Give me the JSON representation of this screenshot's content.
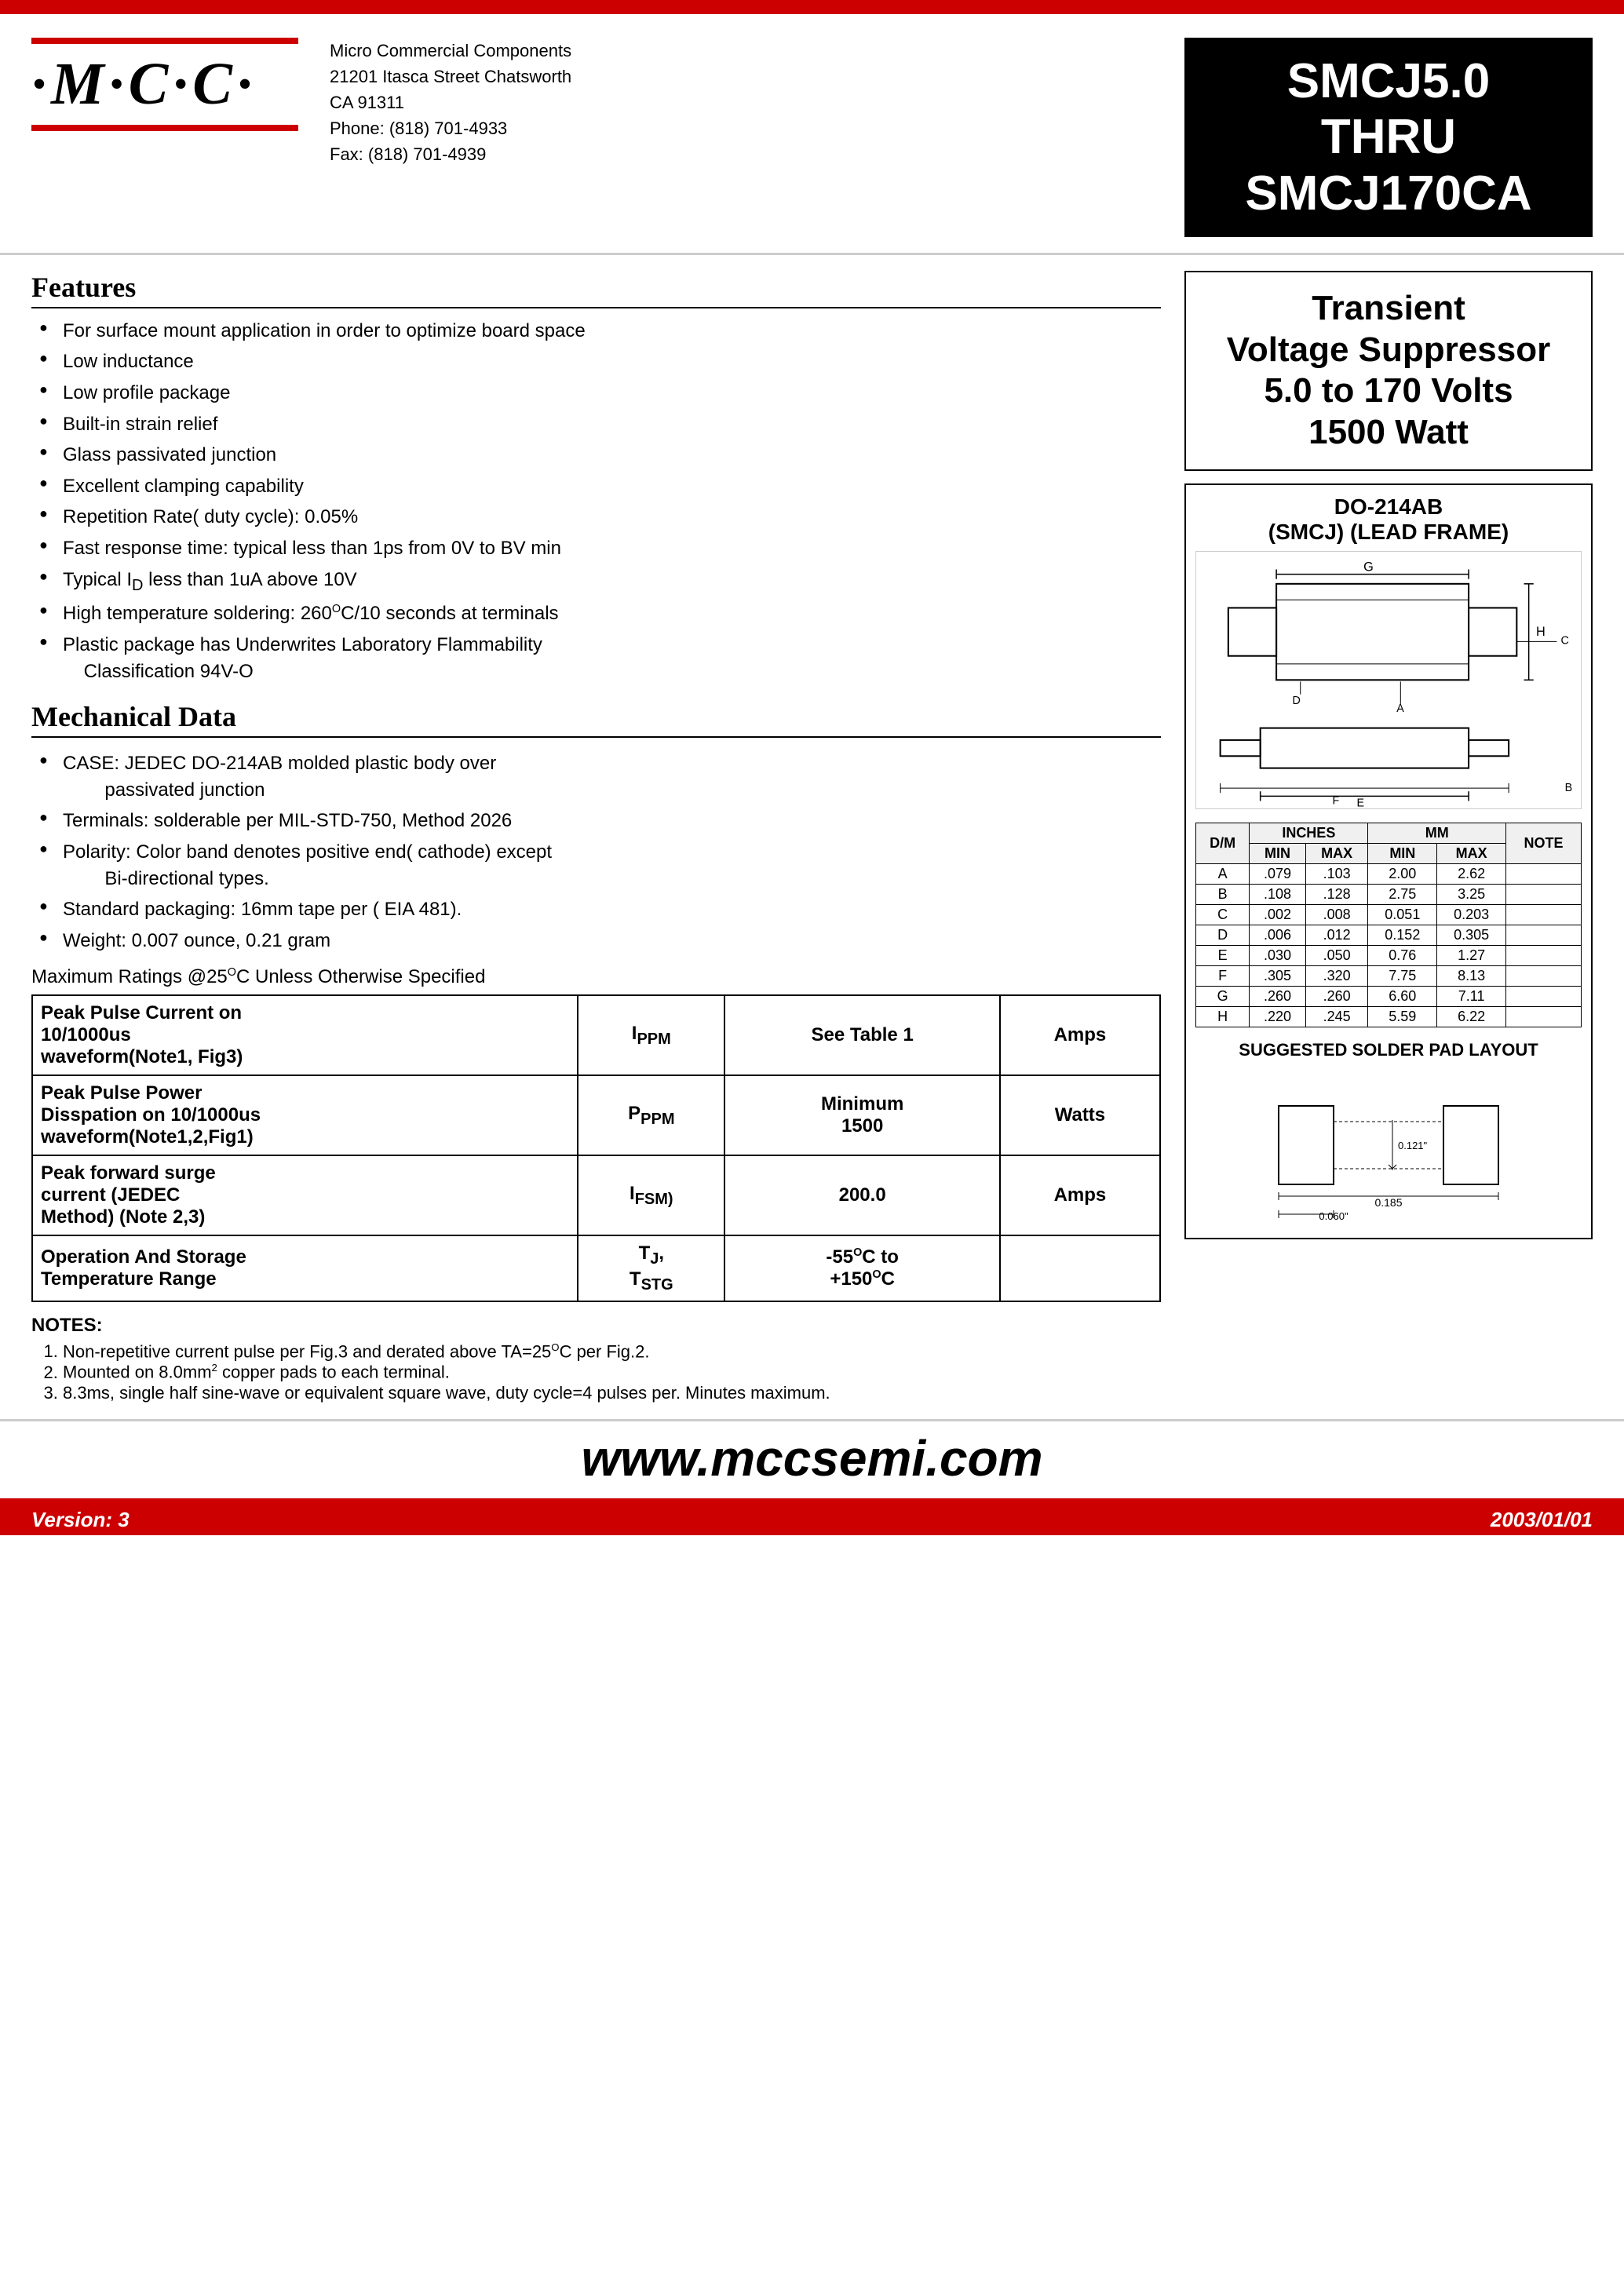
{
  "top_bar": {},
  "header": {
    "logo_text": "·M·C·C·",
    "company_name": "Micro Commercial Components",
    "company_address1": "21201 Itasca Street Chatsworth",
    "company_address2": "CA 91311",
    "company_phone": "Phone: (818) 701-4933",
    "company_fax": "Fax:    (818) 701-4939",
    "part_number": "SMCJ5.0\nTHRU\nSMCJ170CA"
  },
  "transient_box": {
    "line1": "Transient",
    "line2": "Voltage Suppressor",
    "line3": "5.0 to 170 Volts",
    "line4": "1500 Watt"
  },
  "package_box": {
    "title_line1": "DO-214AB",
    "title_line2": "(SMCJ) (LEAD FRAME)"
  },
  "features": {
    "title": "Features",
    "items": [
      "For surface mount application in order to optimize board space",
      "Low inductance",
      "Low profile package",
      "Built-in strain relief",
      "Glass passivated junction",
      "Excellent clamping capability",
      "Repetition Rate( duty cycle): 0.05%",
      "Fast response time: typical less than 1ps from 0V to BV min",
      "Typical I₀ less than 1uA above 10V",
      "High temperature soldering: 260°C/10 seconds at terminals",
      "Plastic package has Underwrites Laboratory Flammability Classification 94V-O"
    ]
  },
  "mechanical_data": {
    "title": "Mechanical Data",
    "items": [
      "CASE: JEDEC DO-214AB molded plastic body over passivated junction",
      "Terminals:  solderable per MIL-STD-750, Method 2026",
      "Polarity: Color band denotes positive end( cathode) except Bi-directional types.",
      "Standard packaging: 16mm tape per ( EIA 481).",
      "Weight: 0.007 ounce, 0.21 gram"
    ]
  },
  "max_ratings_title": "Maximum Ratings @25°C Unless Otherwise Specified",
  "ratings_table": {
    "rows": [
      {
        "col1": "Peak Pulse Current on 10/1000us waveform(Note1, Fig3)",
        "col2": "IPPM",
        "col3": "See Table 1",
        "col4": "Amps"
      },
      {
        "col1": "Peak Pulse Power Disspation on 10/1000us waveform(Note1,2,Fig1)",
        "col2": "PPPM",
        "col3": "Minimum\n1500",
        "col4": "Watts"
      },
      {
        "col1": "Peak forward surge current (JEDEC Method) (Note 2,3)",
        "col2": "IFSM)",
        "col3": "200.0",
        "col4": "Amps"
      },
      {
        "col1": "Operation And Storage Temperature Range",
        "col2": "TJ,\nTSTG",
        "col3": "-55°C to +150°C",
        "col4": ""
      }
    ]
  },
  "notes": {
    "title": "NOTES:",
    "items": [
      "Non-repetitive current pulse per Fig.3 and derated above TA=25°C per Fig.2.",
      "Mounted on 8.0mm² copper pads to each terminal.",
      "8.3ms, single half sine-wave or equivalent square wave, duty cycle=4 pulses per. Minutes maximum."
    ]
  },
  "dimensions_table": {
    "header": [
      "D/M",
      "INCHES MIN",
      "INCHES MAX",
      "MM MIN",
      "MM MAX",
      "NOTE"
    ],
    "rows": [
      [
        "A",
        ".079",
        ".103",
        "2.00",
        "2.62",
        ""
      ],
      [
        "B",
        ".108",
        ".128",
        "2.75",
        "3.25",
        ""
      ],
      [
        "C",
        ".002",
        ".008",
        "0.051",
        "0.203",
        ""
      ],
      [
        "D",
        ".006",
        ".012",
        "0.152",
        "0.305",
        ""
      ],
      [
        "E",
        ".030",
        ".050",
        "0.76",
        "1.27",
        ""
      ],
      [
        "F",
        ".305",
        ".320",
        "7.75",
        "8.13",
        ""
      ],
      [
        "G",
        ".260",
        ".260",
        "6.60",
        "7.11",
        ""
      ],
      [
        "H",
        ".220",
        ".245",
        "5.59",
        "6.22",
        ""
      ]
    ]
  },
  "solder": {
    "title": "SUGGESTED SOLDER PAD LAYOUT",
    "dim1": "0.185",
    "dim2": "0.121\"",
    "dim3": "0.060\""
  },
  "website": {
    "url": "www.mccsemi.com"
  },
  "footer": {
    "version": "Version: 3",
    "date": "2003/01/01"
  }
}
